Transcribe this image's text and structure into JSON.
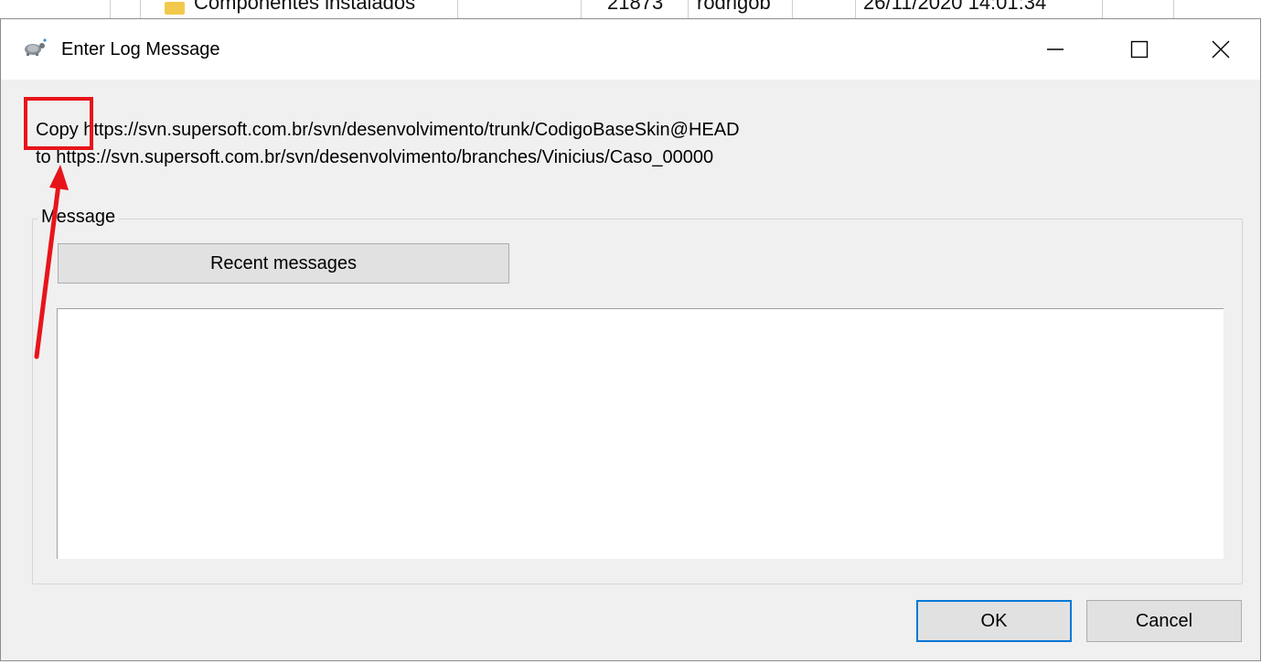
{
  "background_window": {
    "row_name": "Componentes instalados",
    "row_revision": "21873",
    "row_author": "rodrigob",
    "row_date": "26/11/2020 14:01:34"
  },
  "dialog": {
    "title": "Enter Log Message",
    "copy_line": "Copy https://svn.supersoft.com.br/svn/desenvolvimento/trunk/CodigoBaseSkin@HEAD",
    "to_line": "to https://svn.supersoft.com.br/svn/desenvolvimento/branches/Vinicius/Caso_00000",
    "message_group_label": "Message",
    "recent_messages_label": "Recent messages",
    "message_text": "",
    "ok_label": "OK",
    "cancel_label": "Cancel"
  },
  "icons": {
    "app": "tortoisesvn-icon",
    "minimize": "minimize-icon",
    "maximize": "maximize-icon",
    "close": "close-icon"
  },
  "annotation": {
    "highlight_color": "#e8141b",
    "highlight_target": "Copy"
  },
  "colors": {
    "dialog_bg": "#f0f0f0",
    "button_bg": "#e1e1e1",
    "default_button_border": "#0078d7"
  }
}
